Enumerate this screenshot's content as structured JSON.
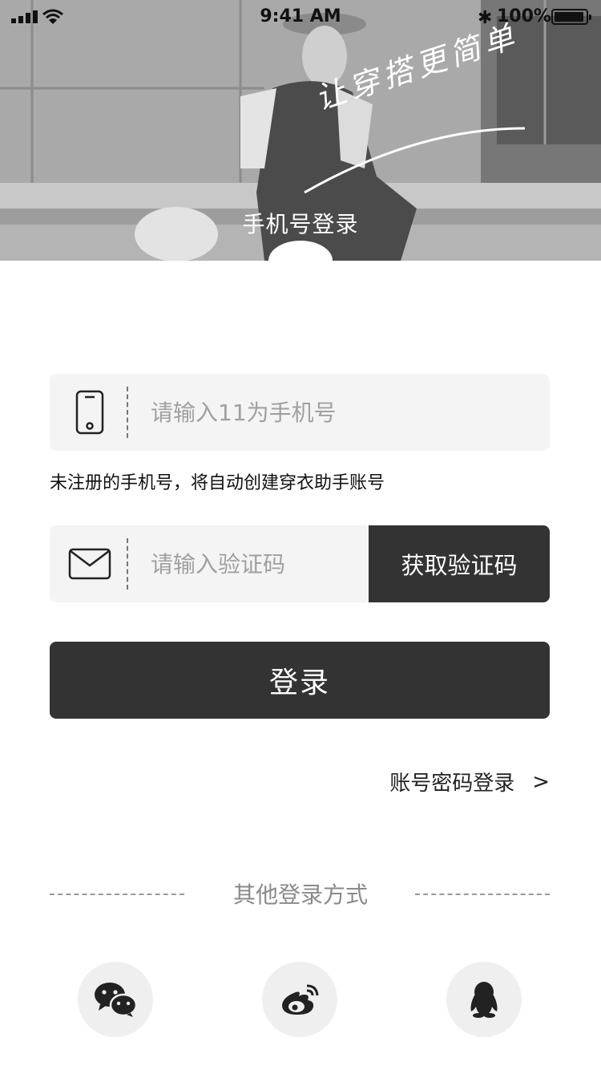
{
  "status_bar": {
    "time": "9:41 AM",
    "battery": "100%",
    "battery_level": 1.0,
    "icons": [
      "signal-icon",
      "wifi-icon",
      "bluetooth-icon",
      "battery-icon"
    ]
  },
  "hero": {
    "title": "手机号登录",
    "slogan": "让穿搭更简单"
  },
  "phone": {
    "placeholder": "请输入11为手机号",
    "value": "",
    "icon": "phone-icon"
  },
  "hint": "未注册的手机号，将自动创建穿衣助手账号",
  "code": {
    "placeholder": "请输入验证码",
    "value": "",
    "icon": "mail-icon",
    "button_label": "获取验证码"
  },
  "login_button": "登录",
  "password_login": {
    "label": "账号密码登录",
    "arrow": ">"
  },
  "other_login": {
    "label": "其他登录方式",
    "options": [
      "wechat-icon",
      "weibo-icon",
      "qq-icon"
    ]
  },
  "colors": {
    "primary": "#333333",
    "field_bg": "#f4f4f4",
    "social_bg": "#efefef",
    "muted_text": "#a0a0a0"
  }
}
